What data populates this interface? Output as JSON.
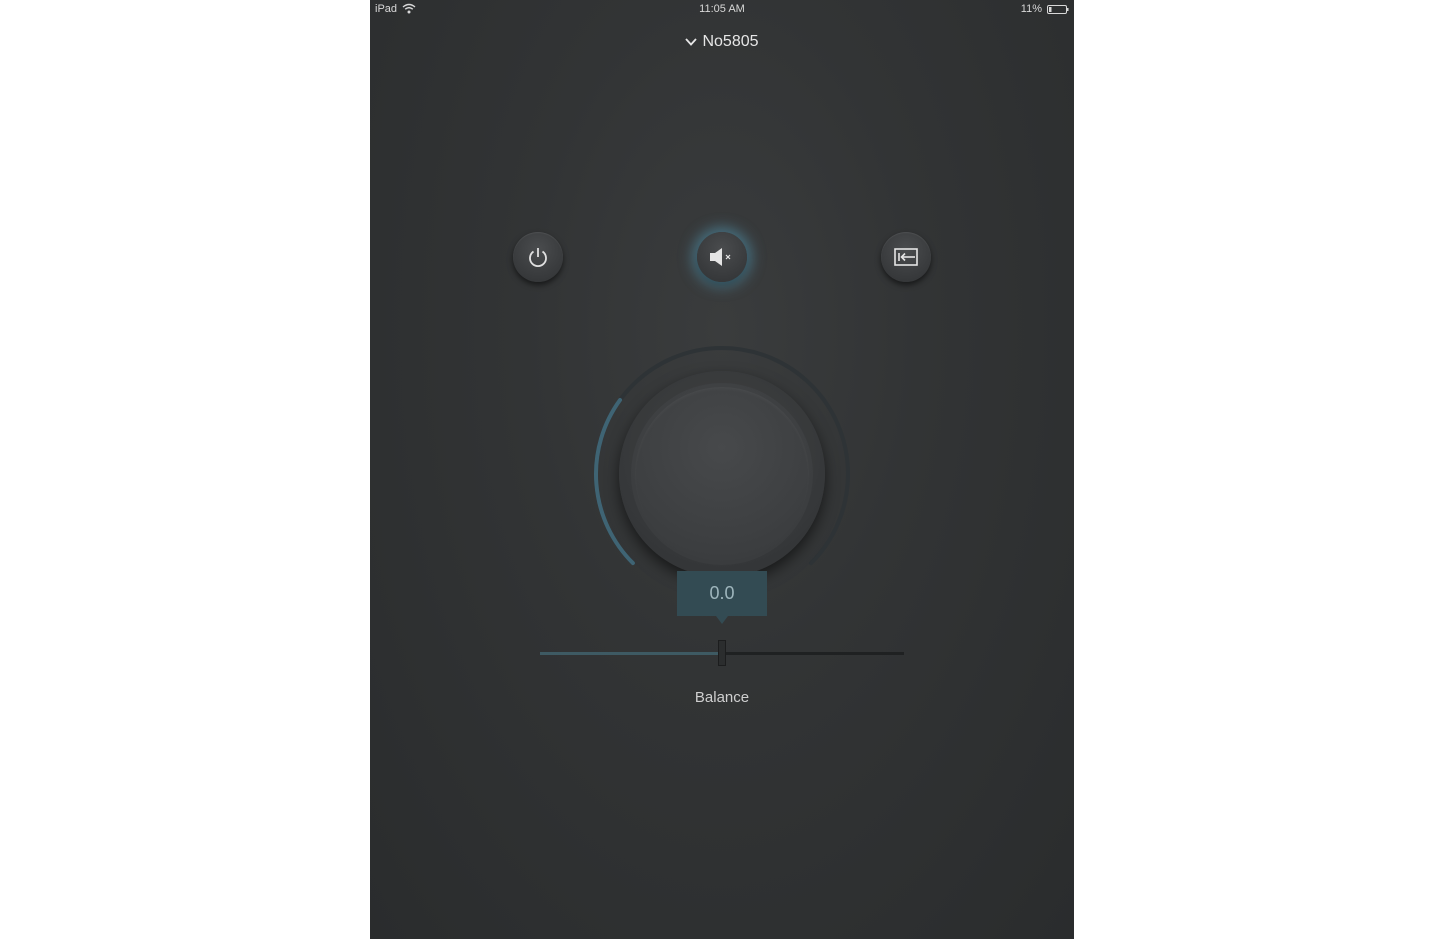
{
  "status_bar": {
    "device": "iPad",
    "time": "11:05 AM",
    "battery": "11%"
  },
  "header": {
    "device_name": "No5805"
  },
  "controls": {
    "power_icon": "power-icon",
    "mute_icon": "speaker-mute-icon",
    "input_icon": "input-source-icon",
    "mute_active": true
  },
  "volume_knob": {
    "level_fraction": 0.3
  },
  "balance": {
    "value": "0.0",
    "label": "Balance",
    "position_fraction": 0.5
  },
  "colors": {
    "accent": "#4f7f8f",
    "glow": "#5aaac8"
  }
}
